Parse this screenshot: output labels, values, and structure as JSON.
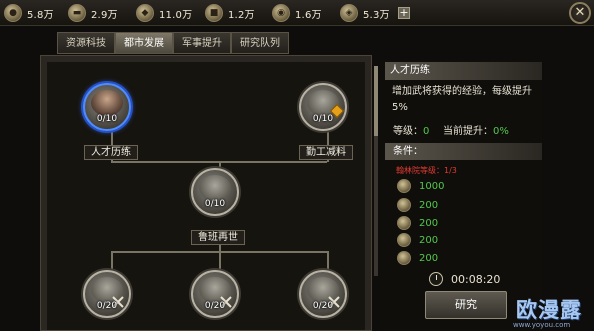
{
  "resources": [
    {
      "icon": "grain-icon",
      "value": "5.8万"
    },
    {
      "icon": "wood-icon",
      "value": "2.9万"
    },
    {
      "icon": "stone-icon",
      "value": "11.0万"
    },
    {
      "icon": "iron-icon",
      "value": "1.2万"
    },
    {
      "icon": "silver-icon",
      "value": "1.6万"
    },
    {
      "icon": "gold-icon",
      "value": "5.3万"
    }
  ],
  "tabs": [
    {
      "label": "资源科技",
      "active": false
    },
    {
      "label": "都市发展",
      "active": true
    },
    {
      "label": "军事提升",
      "active": false
    },
    {
      "label": "研究队列",
      "active": false
    }
  ],
  "tree": {
    "nodes": [
      {
        "label": "人才历练",
        "count": "0/10",
        "selected": true
      },
      {
        "label": "勤工减料",
        "count": "0/10"
      },
      {
        "label": "鲁班再世",
        "count": "0/10"
      },
      {
        "label": "",
        "count": "0/20"
      },
      {
        "label": "",
        "count": "0/20"
      },
      {
        "label": "",
        "count": "0/20"
      }
    ]
  },
  "detail": {
    "title": "人才历练",
    "description": "增加武将获得的经验，每级提升5%",
    "level_label": "等级：",
    "level_value": "0",
    "bonus_label": "当前提升：",
    "bonus_value": "0%",
    "conditions_label": "条件：",
    "requirement": "翰林院等级：1/3",
    "costs": [
      {
        "icon": "grain-icon",
        "value": "1000"
      },
      {
        "icon": "wood-icon",
        "value": "200"
      },
      {
        "icon": "stone-icon",
        "value": "200"
      },
      {
        "icon": "iron-icon",
        "value": "200"
      },
      {
        "icon": "silver-icon",
        "value": "200"
      }
    ],
    "time": "00:08:20",
    "research_button": "研究"
  },
  "watermark": {
    "main": "欧漫露",
    "url": "www.yoyou.com"
  }
}
